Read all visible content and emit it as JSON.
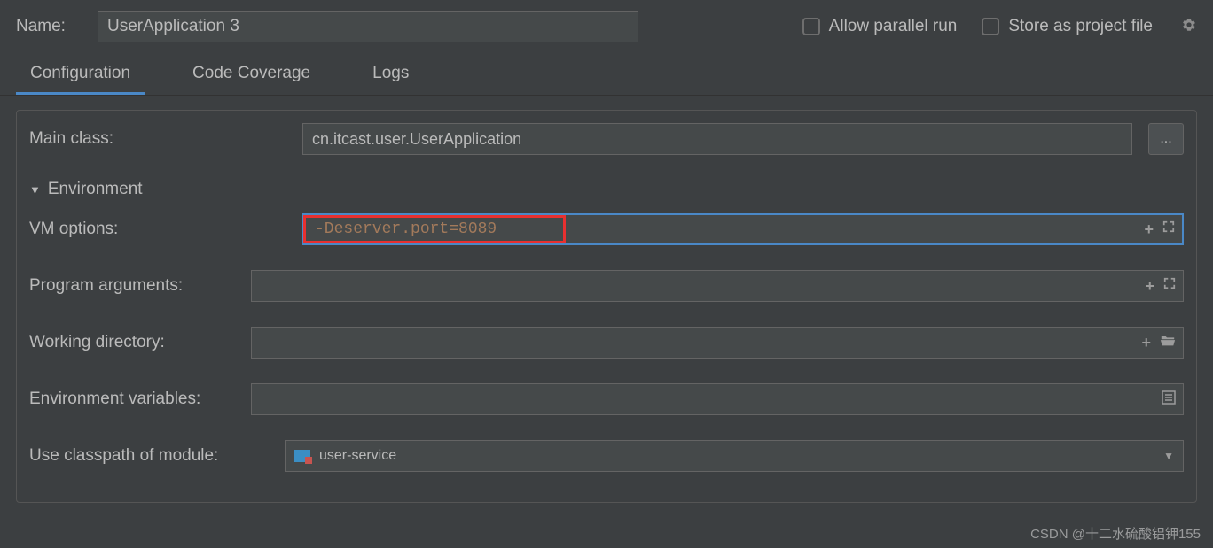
{
  "name": {
    "label": "Name:",
    "value": "UserApplication 3"
  },
  "options": {
    "allow_parallel": "Allow parallel run",
    "store_project_file": "Store as project file"
  },
  "tabs": [
    "Configuration",
    "Code Coverage",
    "Logs"
  ],
  "main_class": {
    "label": "Main class:",
    "value": "cn.itcast.user.UserApplication"
  },
  "environment_header": "Environment",
  "vm_options": {
    "label": "VM options:",
    "value": "-Deserver.port=8089"
  },
  "program_arguments": {
    "label": "Program arguments:",
    "value": ""
  },
  "working_directory": {
    "label": "Working directory:",
    "value": ""
  },
  "environment_variables": {
    "label": "Environment variables:",
    "value": ""
  },
  "classpath_module": {
    "label": "Use classpath of module:",
    "value": "user-service"
  },
  "watermark": "CSDN @十二水硫酸铝钾155"
}
